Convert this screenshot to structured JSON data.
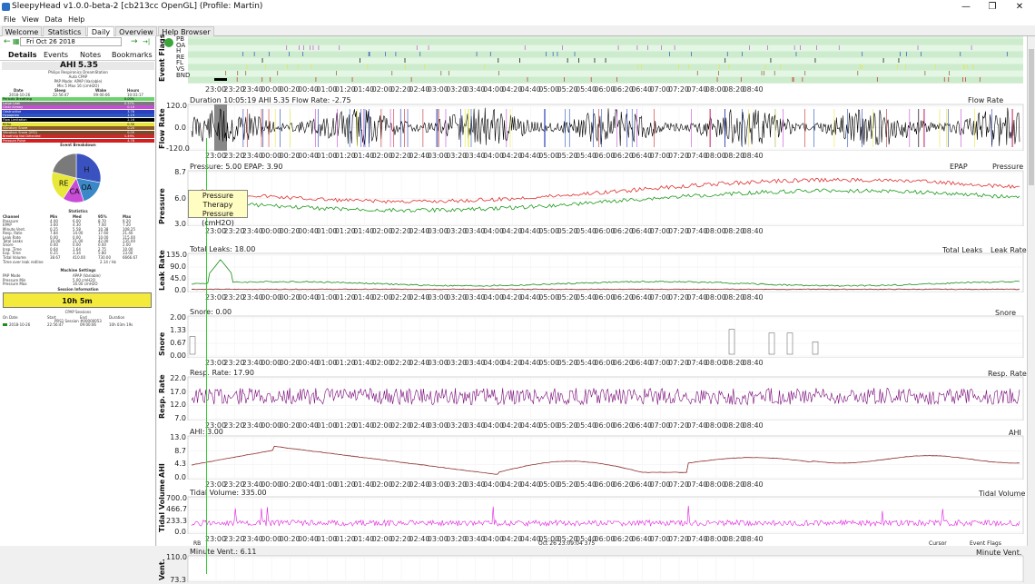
{
  "window": {
    "title": "SleepyHead v1.0.0-beta-2 [cb213cc OpenGL] (Profile: Martin)"
  },
  "menu": [
    "File",
    "View",
    "Data",
    "Help"
  ],
  "tabs": [
    {
      "label": "Welcome",
      "active": false
    },
    {
      "label": "Statistics",
      "active": false
    },
    {
      "label": "Daily",
      "active": true
    },
    {
      "label": "Overview",
      "active": false
    },
    {
      "label": "Help Browser",
      "active": false
    }
  ],
  "left": {
    "nav_prev": "←",
    "date": "Fri Oct 26 2018",
    "nav_next": "→",
    "nav_last": "→|",
    "subtabs": [
      "Details",
      "Events",
      "Notes",
      "Bookmarks"
    ],
    "ahi_label": "AHI",
    "ahi_value": "5.35",
    "machine_info": [
      "Philips Respironics DreamStation",
      "Auto CPAP",
      "PAP Mode: APAP (Variable)",
      "Min 5 Max 16 (cmH2O)"
    ],
    "summary_headers": [
      "Date",
      "Sleep",
      "Wake",
      "Hours"
    ],
    "summary_values": [
      "2018-10-26",
      "22:56:47",
      "09:00:06",
      "10:03:17"
    ],
    "event_rows": [
      {
        "name": "Periodic Breathing",
        "value": "0.00%",
        "color": "#6bd36b",
        "textcolor": "#000"
      },
      {
        "name": "Large Leak",
        "value": "0.37%",
        "color": "#7a7a7a",
        "textcolor": "#fff"
      },
      {
        "name": "Clear Airway",
        "value": "0.10",
        "color": "#c84cd6",
        "textcolor": "#fff"
      },
      {
        "name": "Obstructive",
        "value": "3.78",
        "color": "#2b3fbf",
        "textcolor": "#fff"
      },
      {
        "name": "Hypopnea",
        "value": "1.19",
        "color": "#2a52c0",
        "textcolor": "#fff"
      },
      {
        "name": "Flow Limitation",
        "value": "2.16",
        "color": "#000000",
        "textcolor": "#fff"
      },
      {
        "name": "RERA",
        "value": "0.30",
        "color": "#e8e83a",
        "textcolor": "#000"
      },
      {
        "name": "Vibratory Snore",
        "value": "0.20",
        "color": "#8a5a2a",
        "textcolor": "#fff"
      },
      {
        "name": "Vibratory Snore (VS2)",
        "value": "0.00",
        "color": "#7a4a2a",
        "textcolor": "#fff"
      },
      {
        "name": "Breathing Not Detected",
        "value": "1.49%",
        "color": "#c92a2a",
        "textcolor": "#fff"
      },
      {
        "name": "Pressure Pulse",
        "value": "4.78",
        "color": "#d02020",
        "textcolor": "#fff"
      }
    ],
    "pie_title": "Event Breakdown",
    "pie_slices": [
      {
        "label": "H",
        "value": 0.28,
        "color": "#3a52c0"
      },
      {
        "label": "OA",
        "value": 0.17,
        "color": "#3a88c8"
      },
      {
        "label": "CA",
        "value": 0.14,
        "color": "#c84cd6"
      },
      {
        "label": "RE",
        "value": 0.2,
        "color": "#e8e83a"
      },
      {
        "label": "",
        "value": 0.21,
        "color": "#7a7a7a"
      }
    ],
    "stats_title": "Statistics",
    "stats_headers": [
      "Channel",
      "Min",
      "Med",
      "95%",
      "Max"
    ],
    "stats_rows": [
      [
        "Pressure",
        "4.00",
        "6.00",
        "8.70",
        "9.20"
      ],
      [
        "EPAP",
        "3.60",
        "4.30",
        "7.00",
        "7.20"
      ],
      [
        "Minute Vent.",
        "0.25",
        "5.58",
        "10.38",
        "108.25"
      ],
      [
        "Resp. Rate",
        "7.84",
        "14.00",
        "17.60",
        "21.40"
      ],
      [
        "Leak Rate",
        "0.00",
        "0.00",
        "10.00",
        "115.00"
      ],
      [
        "Total Leaks",
        "10.00",
        "21.00",
        "42.00",
        "135.00"
      ],
      [
        "Snore",
        "0.00",
        "0.00",
        "0.00",
        "2.00"
      ],
      [
        "Insp. Time",
        "0.64",
        "1.64",
        "2.75",
        "10.00"
      ],
      [
        "Exp. Time",
        "0.25",
        "3.34",
        "5.80",
        "13.00"
      ],
      [
        "Tidal Volume",
        "38.67",
        "410.00",
        "730.00",
        "6666.67"
      ]
    ],
    "leak_line_label": "Time over leak redline",
    "leak_line_value": "2.14 / Hz",
    "settings_title": "Machine Settings",
    "settings_rows": [
      [
        "PAP Mode",
        "APAP (Variable)"
      ],
      [
        "Pressure Min",
        "5.00 cmH2O"
      ],
      [
        "Pressure Max",
        "16.00 cmH2O"
      ]
    ],
    "session_title": "Session Information",
    "session_hours": "10h 5m",
    "cpap_title": "CPAP Sessions",
    "session_headers": [
      "On",
      "Date",
      "Start",
      "End",
      "Duration"
    ],
    "session_row": [
      "",
      "2018-10-26",
      "22:56:47",
      "09:00:06",
      "10h 03m 19s"
    ],
    "session_detail": "PRS1 Session #00000053"
  },
  "time_ticks": [
    "23:00",
    "23:20",
    "23:40",
    "00:00",
    "00:20",
    "00:40",
    "01:00",
    "01:20",
    "01:40",
    "02:00",
    "02:20",
    "02:40",
    "03:00",
    "03:20",
    "03:40",
    "04:00",
    "04:20",
    "04:40",
    "05:00",
    "05:20",
    "05:40",
    "06:00",
    "06:20",
    "06:40",
    "07:00",
    "07:20",
    "07:40",
    "08:00",
    "08:20",
    "08:40"
  ],
  "graphs": {
    "event_flags": {
      "ylabel": "Event Flags",
      "flag_labels": [
        "PB",
        "OA",
        "H",
        "RE",
        "FL",
        "VS",
        "BND"
      ]
    },
    "flow": {
      "ylabel": "Flow Rate",
      "header": "Duration 10:05:19 AHI 5.35 Flow Rate: -2.75",
      "legend": "Flow Rate",
      "yticks": [
        "120.0",
        "0.0",
        "-120.0"
      ]
    },
    "pressure": {
      "ylabel": "Pressure",
      "header": "Pressure: 5.00 EPAP: 3.90",
      "legend_epap": "EPAP",
      "legend_pressure": "Pressure",
      "yticks": [
        "8.7",
        "6.0",
        "3.0"
      ],
      "color_pressure": "#e03030",
      "color_epap": "#1a9a1a"
    },
    "leak": {
      "ylabel": "Leak Rate",
      "header": "Total Leaks: 18.00",
      "legend_total": "Total Leaks",
      "legend_leak": "Leak Rate",
      "yticks": [
        "135.0",
        "90.0",
        "45.0",
        "0.0"
      ]
    },
    "snore": {
      "ylabel": "Snore",
      "header": "Snore: 0.00",
      "legend": "Snore",
      "yticks": [
        "2.00",
        "1.33",
        "0.67",
        "0.00"
      ]
    },
    "resp": {
      "ylabel": "Resp. Rate",
      "header": "Resp. Rate: 17.90",
      "legend": "Resp. Rate",
      "yticks": [
        "22.0",
        "17.0",
        "12.0",
        "7.0"
      ],
      "color": "#7a0a7a"
    },
    "ahi": {
      "ylabel": "AHI",
      "header": "AHI: 3.00",
      "legend": "AHI",
      "yticks": [
        "13.0",
        "8.7",
        "4.3",
        "0.0"
      ],
      "color": "#8a2a2a"
    },
    "tidal": {
      "ylabel": "Tidal Volume",
      "header": "Tidal Volume: 335.00",
      "legend": "Tidal Volume",
      "yticks": [
        "700.0",
        "466.7",
        "233.3",
        "0.0"
      ],
      "color": "#e020e0"
    },
    "minvent": {
      "ylabel": "Vent.",
      "header": "Minute Vent.: 6.11",
      "legend": "Minute Vent.",
      "yticks": [
        "110.0",
        "73.3"
      ]
    }
  },
  "tooltip": {
    "title": "Pressure",
    "line2": "Therapy Pressure",
    "line3": "(cmH2O)"
  },
  "status": {
    "left": "RB",
    "center": "Oct 26 23:09:04 375",
    "right1": "Cursor",
    "right2": "Event Flags"
  }
}
